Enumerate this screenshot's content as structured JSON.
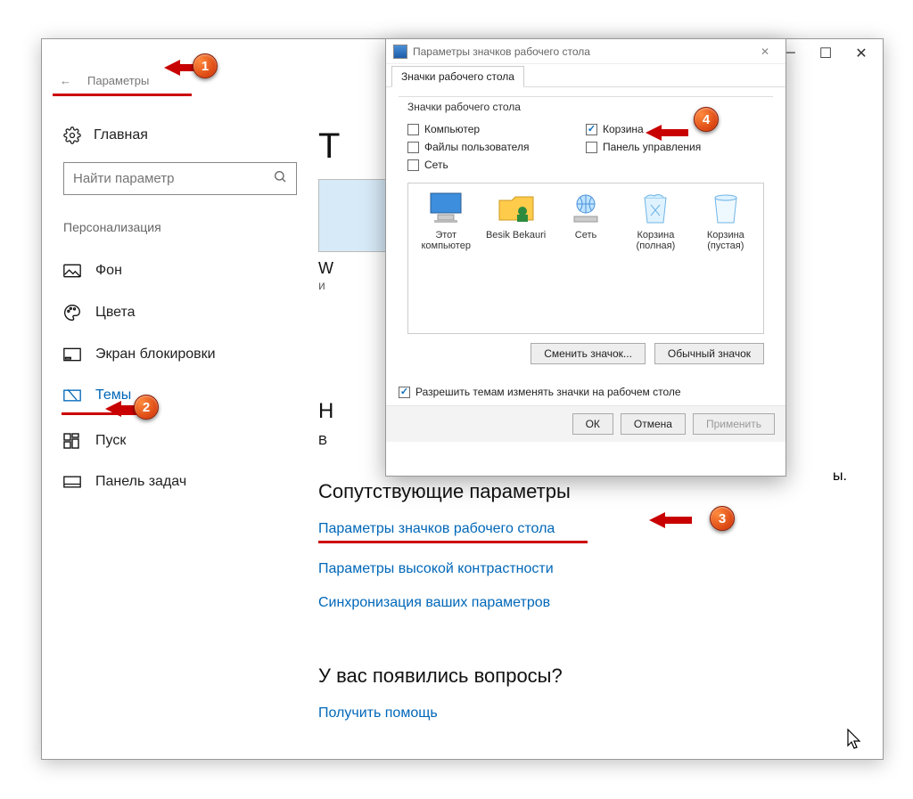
{
  "settings": {
    "window_title": "Параметры",
    "home_label": "Главная",
    "search_placeholder": "Найти параметр",
    "section": "Персонализация",
    "nav": [
      {
        "label": "Фон"
      },
      {
        "label": "Цвета"
      },
      {
        "label": "Экран блокировки"
      },
      {
        "label": "Темы"
      },
      {
        "label": "Пуск"
      },
      {
        "label": "Панель задач"
      }
    ],
    "content": {
      "title_initial": "Т",
      "preview_w": "W",
      "preview_sub": "и",
      "heading_letter": "Н",
      "heading_sub": "В",
      "trailing": "ы.",
      "related_title": "Сопутствующие параметры",
      "link1": "Параметры значков рабочего стола",
      "link2": "Параметры высокой контрастности",
      "link3": "Синхронизация ваших параметров",
      "questions_title": "У вас появились вопросы?",
      "help_link": "Получить помощь"
    }
  },
  "dialog": {
    "title": "Параметры значков рабочего стола",
    "tab": "Значки рабочего стола",
    "fieldset_legend": "Значки рабочего стола",
    "checks": [
      {
        "label": "Компьютер",
        "checked": false
      },
      {
        "label": "Корзина",
        "checked": true
      },
      {
        "label": "Файлы пользователя",
        "checked": false
      },
      {
        "label": "Панель управления",
        "checked": false
      },
      {
        "label": "Сеть",
        "checked": false
      }
    ],
    "icons": [
      {
        "label": "Этот компьютер"
      },
      {
        "label": "Besik Bekauri"
      },
      {
        "label": "Сеть"
      },
      {
        "label": "Корзина (полная)"
      },
      {
        "label": "Корзина (пустая)"
      }
    ],
    "change_icon": "Сменить значок...",
    "default_icon": "Обычный значок",
    "allow_themes": "Разрешить темам изменять значки на рабочем столе",
    "ok": "ОК",
    "cancel": "Отмена",
    "apply": "Применить"
  },
  "markers": {
    "m1": "1",
    "m2": "2",
    "m3": "3",
    "m4": "4"
  }
}
